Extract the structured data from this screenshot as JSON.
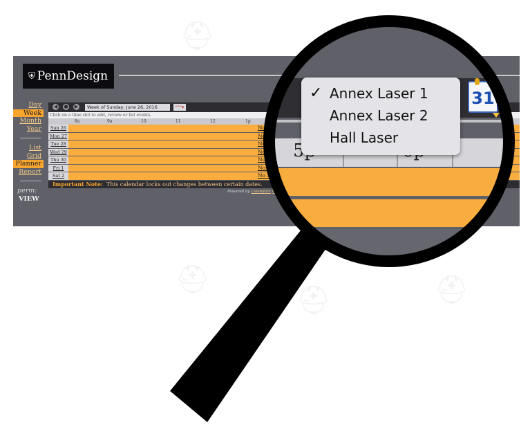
{
  "brand": {
    "logo_text": "PennDesign",
    "shield_glyph": "⛨"
  },
  "left_nav": {
    "items": [
      {
        "label": "Day",
        "selected": false
      },
      {
        "label": "Week",
        "selected": true
      },
      {
        "label": "Month",
        "selected": false
      },
      {
        "label": "Year",
        "selected": false
      },
      {
        "label": "List",
        "selected": false
      },
      {
        "label": "Grid",
        "selected": false
      },
      {
        "label": "Planner",
        "selected": true
      },
      {
        "label": "Report",
        "selected": false
      }
    ],
    "perm_label": "perm:",
    "perm_value": "VIEW"
  },
  "toolbar": {
    "week_value": "Week of Sunday, June 26, 2016",
    "prev_icon": "◀",
    "today_icon": "●",
    "next_icon": "▶",
    "calendar_picker_icon": "\"°\"▾"
  },
  "grid": {
    "hint": "Click on a time slot to add, review or list events.",
    "hours": [
      "8a",
      "9a",
      "10",
      "11",
      "12",
      "1p"
    ],
    "days": [
      "Sun 26",
      "Mon 27",
      "Tue 28",
      "Wed 29",
      "Thu 30",
      "Fri 1",
      "Sat 2"
    ],
    "row_texts": [
      "No",
      "No",
      "No",
      "No",
      "No",
      "No S",
      "No St"
    ]
  },
  "note": {
    "label": "Important Note:",
    "text": "This calendar locks out changes between certain dates."
  },
  "powered": {
    "prefix": "Powered by",
    "link": "Calendars for th"
  },
  "magnified": {
    "dropdown_options": [
      "Annex Laser 1",
      "Annex Laser 2",
      "Hall Laser"
    ],
    "selected_option": "Annex Laser 1",
    "check_glyph": "✓",
    "hours": [
      "5p",
      "6p"
    ],
    "calendar_icon_number": "31"
  },
  "colors": {
    "accent": "#f8a530",
    "panel": "#5f6068",
    "dark": "#2c2c31"
  }
}
